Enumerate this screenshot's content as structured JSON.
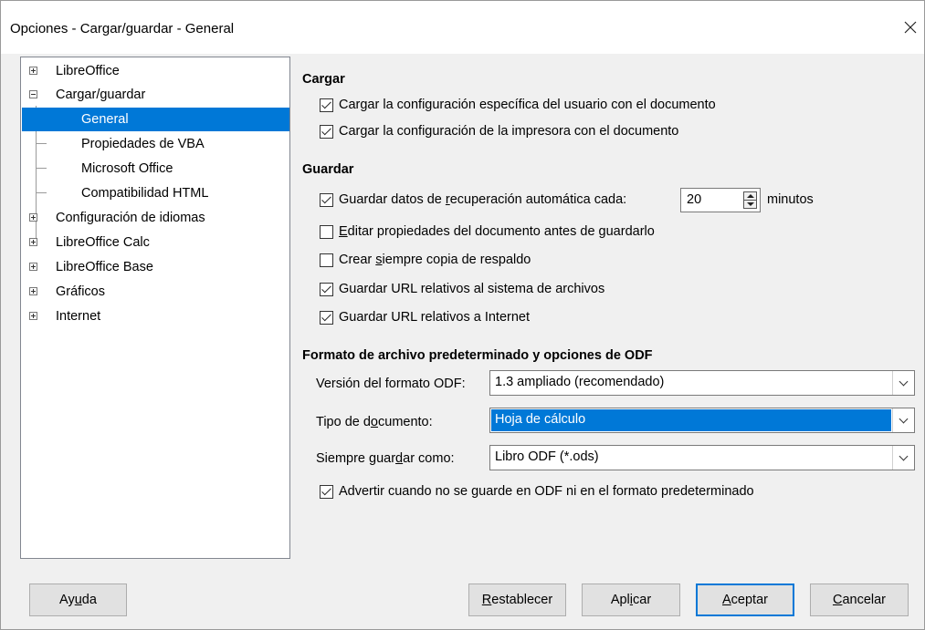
{
  "window": {
    "title": "Opciones - Cargar/guardar - General",
    "close_icon": "close-icon"
  },
  "tree": {
    "items": [
      {
        "label": "LibreOffice",
        "expander": "plus"
      },
      {
        "label": "Cargar/guardar",
        "expander": "minus"
      },
      {
        "label": "General",
        "selected": true
      },
      {
        "label": "Propiedades de VBA"
      },
      {
        "label": "Microsoft Office"
      },
      {
        "label": "Compatibilidad HTML"
      },
      {
        "label": "Configuración de idiomas",
        "expander": "plus"
      },
      {
        "label": "LibreOffice Calc",
        "expander": "plus"
      },
      {
        "label": "LibreOffice Base",
        "expander": "plus"
      },
      {
        "label": "Gráficos",
        "expander": "plus"
      },
      {
        "label": "Internet",
        "expander": "plus"
      }
    ]
  },
  "load": {
    "title": "Cargar",
    "user_settings": {
      "label": "Cargar la configuración específica del usuario con el documento",
      "checked": true
    },
    "printer_settings": {
      "label": "Cargar la configuración de la impresora con el documento",
      "checked": true
    }
  },
  "save": {
    "title": "Guardar",
    "autorecovery": {
      "label_pre": "Guardar datos de ",
      "label_u": "r",
      "label_post": "ecuperación automática cada:",
      "checked": true,
      "value": "20",
      "unit": "minutos"
    },
    "edit_props": {
      "label_u": "E",
      "label_post": "ditar propiedades del documento antes de guardarlo",
      "checked": false
    },
    "backup": {
      "label_pre": "Crear ",
      "label_u": "s",
      "label_post": "iempre copia de respaldo",
      "checked": false
    },
    "url_fs": {
      "label": "Guardar URL relativos al sistema de archivos",
      "checked": true
    },
    "url_internet": {
      "label": "Guardar URL relativos a Internet",
      "checked": true
    }
  },
  "format": {
    "title": "Formato de archivo predeterminado y opciones de ODF",
    "odf_version": {
      "label": "Versión del formato ODF:",
      "value": "1.3 ampliado (recomendado)"
    },
    "doc_type": {
      "label_pre": "Tipo de d",
      "label_u": "o",
      "label_post": "cumento:",
      "value": "Hoja de cálculo"
    },
    "always_save": {
      "label_pre": "Siempre guar",
      "label_u": "d",
      "label_post": "ar como:",
      "value": "Libro ODF (*.ods)"
    },
    "warn": {
      "label": "Advertir cuando no se guarde en ODF ni en el formato predeterminado",
      "checked": true
    }
  },
  "buttons": {
    "help": {
      "pre": "Ay",
      "u": "u",
      "post": "da"
    },
    "reset": {
      "pre": "",
      "u": "R",
      "post": "establecer"
    },
    "apply": {
      "pre": "Apl",
      "u": "i",
      "post": "car"
    },
    "ok": {
      "pre": "",
      "u": "A",
      "post": "ceptar"
    },
    "cancel": {
      "pre": "",
      "u": "C",
      "post": "ancelar"
    }
  }
}
